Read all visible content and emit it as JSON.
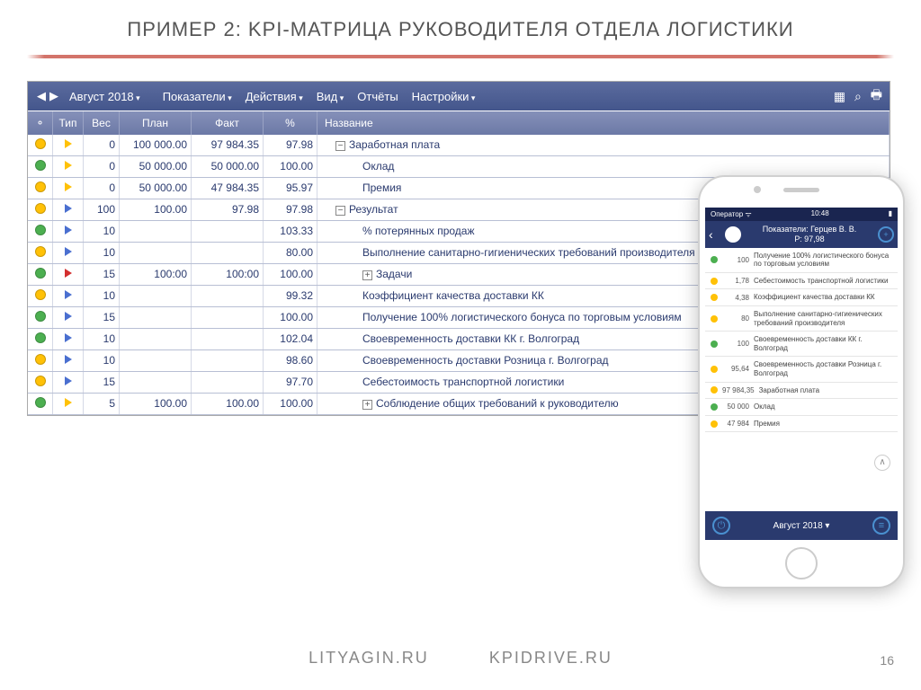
{
  "title": "ПРИМЕР 2:  KPI-МАТРИЦА РУКОВОДИТЕЛЯ ОТДЕЛА ЛОГИСТИКИ",
  "period": "Август 2018",
  "menu": {
    "m1": "Показатели",
    "m2": "Действия",
    "m3": "Вид",
    "m4": "Отчёты",
    "m5": "Настройки"
  },
  "head": {
    "type": "Тип",
    "weight": "Вес",
    "plan": "План",
    "fact": "Факт",
    "pct": "%",
    "name": "Название"
  },
  "rows": [
    {
      "light": "yellow",
      "tri": "yellow",
      "weight": "0",
      "plan": "100 000.00",
      "fact": "97 984.35",
      "pct": "97.98",
      "exp": "−",
      "indent": 1,
      "name": "Заработная плата"
    },
    {
      "light": "green",
      "tri": "yellow",
      "weight": "0",
      "plan": "50 000.00",
      "fact": "50 000.00",
      "pct": "100.00",
      "indent": 2,
      "name": "Оклад"
    },
    {
      "light": "yellow",
      "tri": "yellow",
      "weight": "0",
      "plan": "50 000.00",
      "fact": "47 984.35",
      "pct": "95.97",
      "indent": 2,
      "name": "Премия"
    },
    {
      "light": "yellow",
      "tri": "blue",
      "weight": "100",
      "plan": "100.00",
      "fact": "97.98",
      "pct": "97.98",
      "exp": "−",
      "indent": 1,
      "name": "Результат"
    },
    {
      "light": "green",
      "tri": "blue",
      "weight": "10",
      "plan": "",
      "fact": "",
      "pct": "103.33",
      "indent": 2,
      "name": "% потерянных продаж"
    },
    {
      "light": "yellow",
      "tri": "blue",
      "weight": "10",
      "plan": "",
      "fact": "",
      "pct": "80.00",
      "indent": 2,
      "name": "Выполнение санитарно-гигиенических требований производителя"
    },
    {
      "light": "green",
      "tri": "red",
      "weight": "15",
      "plan": "100:00",
      "fact": "100:00",
      "pct": "100.00",
      "exp": "+",
      "indent": 2,
      "name": "Задачи"
    },
    {
      "light": "yellow",
      "tri": "blue",
      "weight": "10",
      "plan": "",
      "fact": "",
      "pct": "99.32",
      "indent": 2,
      "name": "Коэффициент качества доставки КК"
    },
    {
      "light": "green",
      "tri": "blue",
      "weight": "15",
      "plan": "",
      "fact": "",
      "pct": "100.00",
      "indent": 2,
      "name": "Получение 100% логистического бонуса по торговым условиям"
    },
    {
      "light": "green",
      "tri": "blue",
      "weight": "10",
      "plan": "",
      "fact": "",
      "pct": "102.04",
      "indent": 2,
      "name": "Своевременность доставки КК г. Волгоград"
    },
    {
      "light": "yellow",
      "tri": "blue",
      "weight": "10",
      "plan": "",
      "fact": "",
      "pct": "98.60",
      "indent": 2,
      "name": "Своевременность доставки Розница г. Волгоград"
    },
    {
      "light": "yellow",
      "tri": "blue",
      "weight": "15",
      "plan": "",
      "fact": "",
      "pct": "97.70",
      "indent": 2,
      "name": "Себестоимость транспортной логистики"
    },
    {
      "light": "green",
      "tri": "yellow",
      "weight": "5",
      "plan": "100.00",
      "fact": "100.00",
      "pct": "100.00",
      "exp": "+",
      "indent": 2,
      "name": "Соблюдение общих требований к руководителю"
    }
  ],
  "phone": {
    "operator": "Оператор",
    "time": "10:48",
    "head1": "Показатели: Герцев В. В.",
    "head2": "Р: 97,98",
    "foot": "Август 2018 ▾",
    "items": [
      {
        "c": "#4caf50",
        "v": "100",
        "n": "Получение 100% логистического бонуса по торговым условиям"
      },
      {
        "c": "#ffc107",
        "v": "1,78",
        "n": "Себестоимость транспортной логистики"
      },
      {
        "c": "#ffc107",
        "v": "4,38",
        "n": "Коэффициент качества доставки КК"
      },
      {
        "c": "#ffc107",
        "v": "80",
        "n": "Выполнение санитарно-гигиенических требований производителя"
      },
      {
        "c": "#4caf50",
        "v": "100",
        "n": "Своевременность доставки КК г. Волгоград"
      },
      {
        "c": "#ffc107",
        "v": "95,64",
        "n": "Своевременность доставки Розница г. Волгоград"
      },
      {
        "c": "#ffc107",
        "v": "97 984,35",
        "n": "Заработная плата"
      },
      {
        "c": "#4caf50",
        "v": "50 000",
        "n": "Оклад"
      },
      {
        "c": "#ffc107",
        "v": "47 984",
        "n": "Премия"
      }
    ]
  },
  "footer": {
    "s1": "LITYAGIN.RU",
    "s2": "KPIDRIVE.RU"
  },
  "page": "16"
}
